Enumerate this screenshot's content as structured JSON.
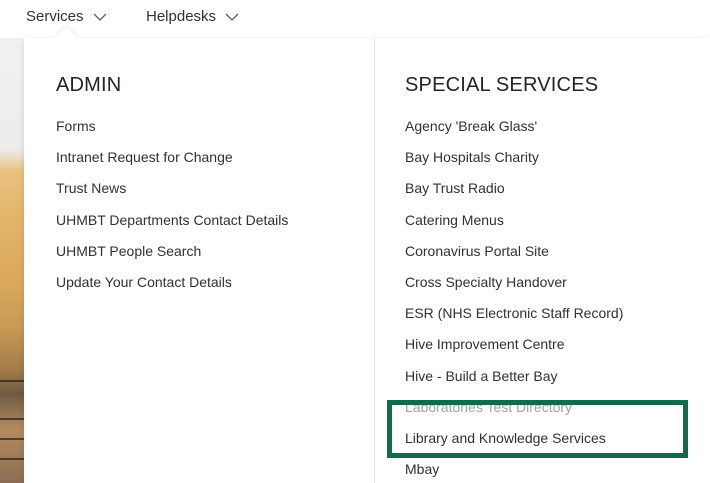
{
  "nav": {
    "items": [
      {
        "label": "Services",
        "icon": "chevron-down-icon"
      },
      {
        "label": "Helpdesks",
        "icon": "chevron-down-icon"
      }
    ]
  },
  "admin": {
    "heading": "ADMIN",
    "links": [
      "Forms",
      "Intranet Request for Change",
      "Trust News",
      "UHMBT Departments Contact Details",
      "UHMBT People Search",
      "Update Your Contact Details"
    ]
  },
  "special_services": {
    "heading": "SPECIAL SERVICES",
    "links": [
      "Agency 'Break Glass'",
      "Bay Hospitals Charity",
      "Bay Trust Radio",
      "Catering Menus",
      "Coronavirus Portal Site",
      "Cross Specialty Handover",
      "ESR (NHS Electronic Staff Record)",
      "Hive Improvement Centre",
      "Hive - Build a Better Bay",
      "Laboratories Test Directory",
      "Library and Knowledge Services",
      "Mbay"
    ]
  },
  "colors": {
    "highlight_border": "#0f6b4c",
    "text": "#323130",
    "heading": "#252423"
  }
}
